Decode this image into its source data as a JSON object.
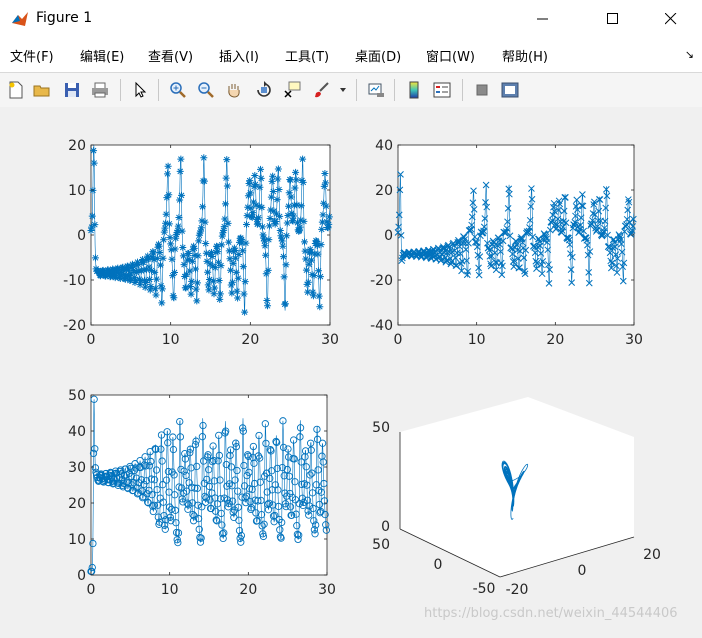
{
  "window": {
    "title": "Figure 1"
  },
  "menu": [
    {
      "label": "文件(F)"
    },
    {
      "label": "编辑(E)"
    },
    {
      "label": "查看(V)"
    },
    {
      "label": "插入(I)"
    },
    {
      "label": "工具(T)"
    },
    {
      "label": "桌面(D)"
    },
    {
      "label": "窗口(W)"
    },
    {
      "label": "帮助(H)"
    }
  ],
  "toolbar_icons": [
    "new-figure-icon",
    "open-file-icon",
    "save-icon",
    "print-icon",
    "pointer-icon",
    "zoom-in-icon",
    "zoom-out-icon",
    "pan-hand-icon",
    "rotate-3d-icon",
    "data-cursor-icon",
    "brush-icon",
    "link-plot-icon",
    "colorbar-icon",
    "legend-icon",
    "hide-plot-tools-icon",
    "show-plot-tools-icon"
  ],
  "colors": {
    "series": "#0072bd",
    "axes_bg": "#ffffff",
    "figure_bg": "#f0f0f0"
  },
  "watermark": "https://blog.csdn.net/weixin_44544406",
  "chart_data": [
    {
      "type": "scatter",
      "marker": "*",
      "x_range": [
        0,
        30
      ],
      "ylim": [
        -20,
        20
      ],
      "xticks": [
        "0",
        "10",
        "20",
        "30"
      ],
      "yticks": [
        "20",
        "10",
        "0",
        "-10",
        "-20"
      ],
      "description_values": {
        "oscillation_peak": 18,
        "oscillation_trough": -18
      }
    },
    {
      "type": "scatter",
      "marker": "x",
      "x_range": [
        0,
        30
      ],
      "ylim": [
        -40,
        40
      ],
      "xticks": [
        "0",
        "10",
        "20",
        "30"
      ],
      "yticks": [
        "40",
        "20",
        "0",
        "-20",
        "-40"
      ]
    },
    {
      "type": "scatter",
      "marker": "o",
      "x_range": [
        0,
        30
      ],
      "ylim": [
        0,
        50
      ],
      "xticks": [
        "0",
        "10",
        "20",
        "30"
      ],
      "yticks": [
        "50",
        "40",
        "30",
        "20",
        "10",
        "0"
      ]
    },
    {
      "type": "line3d",
      "x_ticks": [
        "-20",
        "0",
        "20"
      ],
      "y_ticks": [
        "50",
        "0",
        "-50"
      ],
      "z_ticks": [
        "50",
        "0"
      ]
    }
  ]
}
